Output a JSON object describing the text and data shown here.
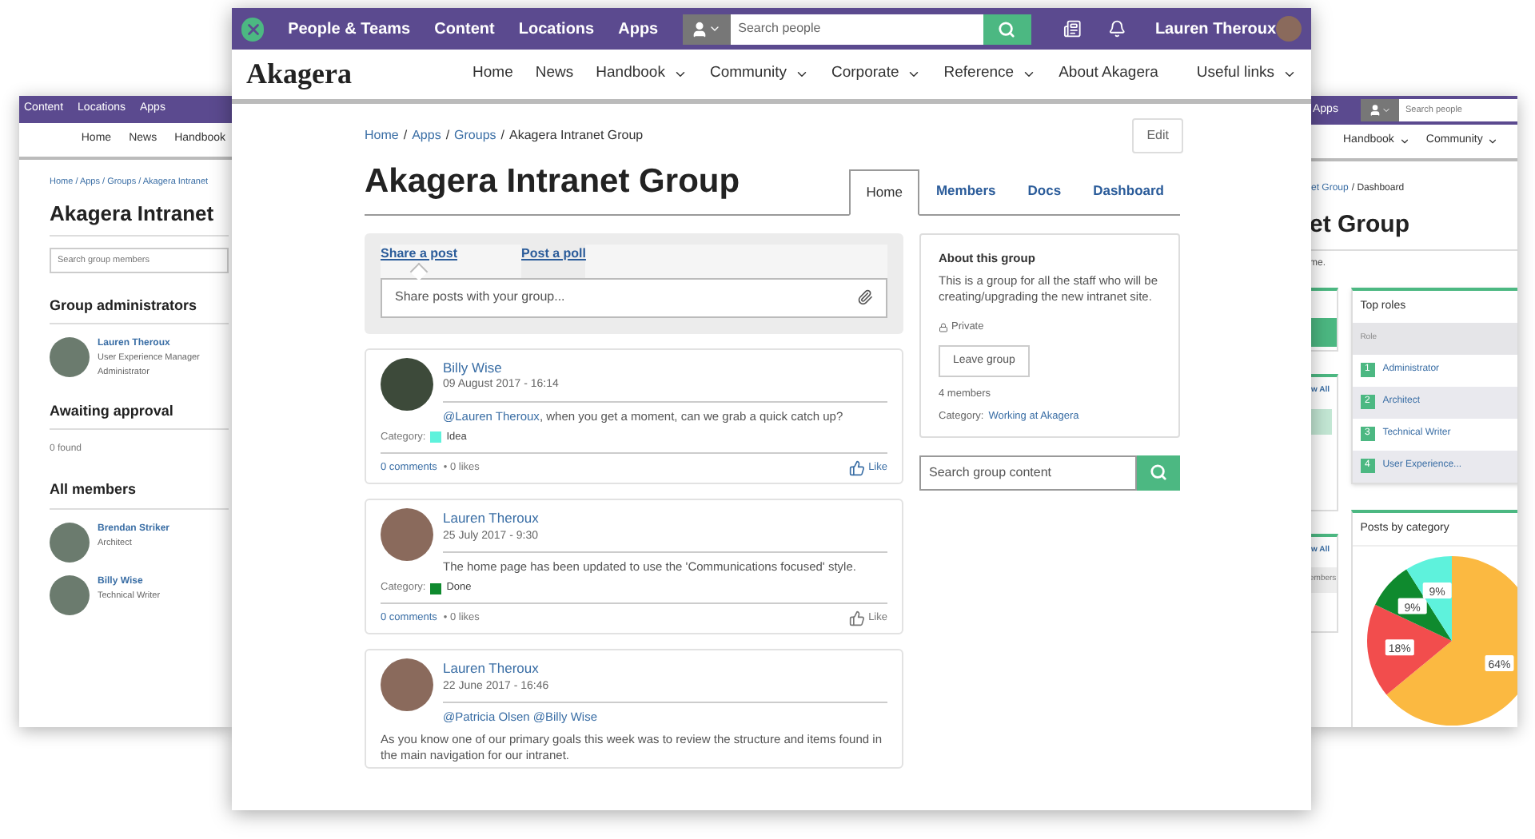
{
  "left_window": {
    "nav": [
      "Content",
      "Locations",
      "Apps"
    ],
    "menu": [
      "Home",
      "News",
      "Handbook"
    ],
    "breadcrumb": "Home / Apps / Groups / Akagera Intranet",
    "title": "Akagera Intranet",
    "search": {
      "placeholder": "Search group members"
    },
    "sections": [
      {
        "heading": "Group administrators",
        "members": [
          {
            "name": "Lauren Theroux",
            "lines": [
              "User Experience Manager",
              "Administrator"
            ]
          }
        ]
      },
      {
        "heading": "Awaiting approval",
        "empty": "0 found"
      },
      {
        "heading": "All members",
        "members": [
          {
            "name": "Brendan Striker",
            "lines": [
              "Architect"
            ]
          },
          {
            "name": "Billy Wise",
            "lines": [
              "Technical Writer"
            ]
          }
        ]
      }
    ]
  },
  "right_window": {
    "nav": [
      "Apps"
    ],
    "search": {
      "placeholder": "Search people"
    },
    "menu": [
      "Handbook",
      "Community"
    ],
    "breadcrumb_link": "et Group",
    "breadcrumb_current": "/ Dashboard",
    "title": "et Group",
    "intro": "me.",
    "view_all": [
      "w All",
      "w All"
    ],
    "members_col": "embers",
    "top_roles": {
      "title": "Top roles",
      "column": "Role",
      "rows": [
        {
          "rank": "1",
          "name": "Administrator"
        },
        {
          "rank": "2",
          "name": "Architect"
        },
        {
          "rank": "3",
          "name": "Technical Writer"
        },
        {
          "rank": "4",
          "name": "User Experience..."
        }
      ]
    },
    "posts_chart": {
      "title": "Posts by category",
      "chart_data": {
        "type": "pie",
        "values": [
          64,
          18,
          9,
          9
        ],
        "colors": [
          "#fbb941",
          "#f24d4d",
          "#0f8a2e",
          "#5ef2dc"
        ],
        "value_labels": [
          "64%",
          "18%",
          "9%",
          "9%"
        ]
      }
    }
  },
  "main_window": {
    "topbar": {
      "nav": [
        "People & Teams",
        "Content",
        "Locations",
        "Apps"
      ],
      "search": {
        "placeholder": "Search people"
      },
      "user": "Lauren Theroux"
    },
    "site": {
      "logo": "Akagera",
      "menu": [
        {
          "label": "Home",
          "dropdown": false
        },
        {
          "label": "News",
          "dropdown": false
        },
        {
          "label": "Handbook",
          "dropdown": true
        },
        {
          "label": "Community",
          "dropdown": true
        },
        {
          "label": "Corporate",
          "dropdown": true
        },
        {
          "label": "Reference",
          "dropdown": true
        },
        {
          "label": "About Akagera",
          "dropdown": false
        },
        {
          "label": "Useful links",
          "dropdown": true
        }
      ]
    },
    "breadcrumb": {
      "separator": "/",
      "items": [
        {
          "label": "Home",
          "link": true
        },
        {
          "label": "Apps",
          "link": true
        },
        {
          "label": "Groups",
          "link": true
        },
        {
          "label": "Akagera Intranet Group",
          "link": false
        }
      ]
    },
    "edit": "Edit",
    "title": "Akagera Intranet Group",
    "tabs": [
      {
        "label": "Home",
        "selected": true
      },
      {
        "label": "Members",
        "selected": false
      },
      {
        "label": "Docs",
        "selected": false
      },
      {
        "label": "Dashboard",
        "selected": false
      }
    ],
    "composer": {
      "tabs": [
        {
          "label": "Share a post",
          "selected": true
        },
        {
          "label": "Post a poll",
          "selected": false
        }
      ],
      "placeholder": "Share posts with your group..."
    },
    "posts": [
      {
        "author": "Billy Wise",
        "date": "09 August 2017 - 16:14",
        "mention": "@Lauren Theroux",
        "text": ", when you get a moment, can we grab a quick catch up?",
        "category_label": "Category:",
        "category": "Idea",
        "color": "#5ef2dc",
        "comments": "0 comments",
        "likes": "• 0 likes",
        "like": "Like",
        "liked": true
      },
      {
        "author": "Lauren Theroux",
        "date": "25 July 2017 - 9:30",
        "text": "The home page has been updated to use the 'Communications focused' style.",
        "category_label": "Category:",
        "category": "Done",
        "color": "#0f8a2e",
        "comments": "0 comments",
        "likes": "• 0 likes",
        "like": "Like",
        "liked": false
      },
      {
        "author": "Lauren Theroux",
        "date": "22 June 2017 - 16:46",
        "mention": "@Patricia Olsen @Billy Wise",
        "body": "As you know one of our primary goals this week was to review the structure and items found in the main navigation for our intranet."
      }
    ],
    "about": {
      "heading": "About this group",
      "description": "This is a group for all the staff who will be creating/upgrading the new intranet site.",
      "privacy": "Private",
      "button": "Leave group",
      "members": "4 members",
      "category_label": "Category:",
      "category": "Working at Akagera"
    },
    "group_search": {
      "placeholder": "Search group content"
    }
  }
}
